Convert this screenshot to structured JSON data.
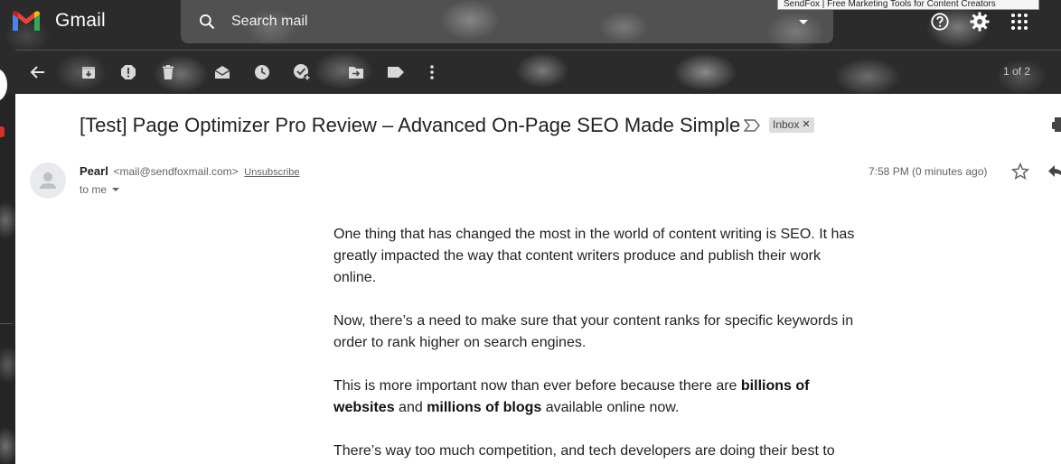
{
  "app": {
    "name": "Gmail",
    "colors": {
      "gmail_red": "#EA4335",
      "gmail_blue": "#4285F4",
      "gmail_green": "#34A853",
      "gmail_yellow": "#FBBC04"
    }
  },
  "search": {
    "placeholder": "Search mail"
  },
  "tooltip": "SendFox | Free Marketing Tools for Content Creators",
  "header_icons": [
    "help-icon",
    "settings-gear-icon",
    "apps-grid-icon"
  ],
  "toolbar": {
    "icons": [
      "back-arrow-icon",
      "archive-icon",
      "report-spam-icon",
      "delete-icon",
      "mark-unread-icon",
      "snooze-icon",
      "add-to-tasks-icon",
      "move-to-icon",
      "labels-icon",
      "more-vert-icon"
    ],
    "pager": "1 of 2"
  },
  "email": {
    "subject": "[Test] Page Optimizer Pro Review – Advanced On-Page SEO Made Simple",
    "label": "Inbox",
    "sender_name": "Pearl",
    "sender_email": "<mail@sendfoxmail.com>",
    "unsubscribe": "Unsubscribe",
    "to": "to me",
    "time": "7:58 PM (0 minutes ago)",
    "paragraphs": {
      "p1": "One thing that has changed the most in the world of content writing is SEO. It has greatly impacted the way that content writers produce and publish their work online.",
      "p2": "Now, there’s a need to make sure that your content ranks for specific keywords in order to rank higher on search engines.",
      "p3_a": "This is more important now than ever before because there are ",
      "p3_b": "billions of websites",
      "p3_c": " and ",
      "p3_d": "millions of blogs",
      "p3_e": " available online now.",
      "p4": "There’s way too much competition, and tech developers are doing their best to"
    }
  }
}
